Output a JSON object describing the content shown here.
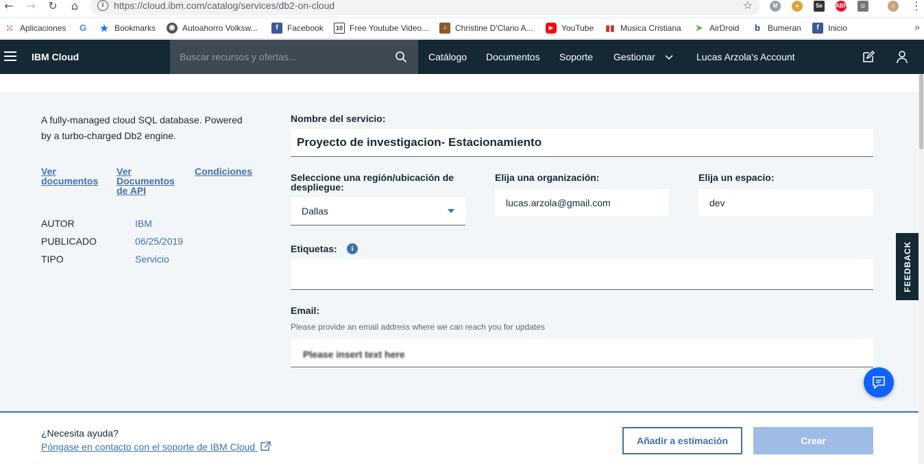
{
  "browser": {
    "url": "https://cloud.ibm.com/catalog/services/db2-on-cloud",
    "bookmarks": [
      {
        "label": "Aplicaciones",
        "icon": "apps-grid-icon",
        "color": "#e8453c"
      },
      {
        "label": "",
        "icon": "google-icon",
        "color": "#4285f4"
      },
      {
        "label": "Bookmarks",
        "icon": "star-icon",
        "color": "#1a73e8"
      },
      {
        "label": "Autoahorro Volksw...",
        "icon": "globe-icon",
        "color": "#555555"
      },
      {
        "label": "Facebook",
        "icon": "facebook-icon",
        "color": "#3b5998"
      },
      {
        "label": "Free Youtube Video...",
        "icon": "10-icon",
        "color": "#333333"
      },
      {
        "label": "Christine D'Clario A...",
        "icon": "music-note-icon",
        "color": "#8a5a2b"
      },
      {
        "label": "YouTube",
        "icon": "youtube-icon",
        "color": "#ff0000"
      },
      {
        "label": "Musica Cristiana",
        "icon": "equalizer-icon",
        "color": "#c0392b"
      },
      {
        "label": "AirDroid",
        "icon": "airdroid-icon",
        "color": "#6ab04c"
      },
      {
        "label": "Bumeran",
        "icon": "bumeran-icon",
        "color": "#1e4e8c"
      },
      {
        "label": "Inicio",
        "icon": "facebook-icon",
        "color": "#3b5998"
      }
    ],
    "more": "»"
  },
  "header": {
    "brand": "IBM Cloud",
    "search_placeholder": "Buscar recursos y ofertas...",
    "nav": {
      "catalog": "Catálogo",
      "docs": "Documentos",
      "support": "Soporte",
      "manage": "Gestionar",
      "account": "Lucas Arzola's Account"
    }
  },
  "sidebar": {
    "description": "A fully-managed cloud SQL database. Powered by a turbo-charged Db2 engine.",
    "links": {
      "docs": [
        "Ver",
        "documentos"
      ],
      "api": [
        "Ver",
        "Documentos",
        "de API"
      ],
      "terms": "Condiciones"
    },
    "meta": [
      {
        "key": "AUTOR",
        "value": "IBM"
      },
      {
        "key": "PUBLICADO",
        "value": "06/25/2019"
      },
      {
        "key": "TIPO",
        "value": "Servicio"
      }
    ]
  },
  "form": {
    "service_name_label": "Nombre del servicio:",
    "service_name_value": "Proyecto de investigacion- Estacionamiento",
    "region_label": "Seleccione una región/ubicación de despliegue:",
    "region_value": "Dallas",
    "org_label": "Elija una organización:",
    "org_value": "lucas.arzola@gmail.com",
    "space_label": "Elija un espacio:",
    "space_value": "dev",
    "tags_label": "Etiquetas:",
    "email_label": "Email:",
    "email_hint": "Please provide an email address where we can reach you for updates",
    "email_placeholder": "Please insert text here"
  },
  "feedback": "FEEDBACK",
  "footer": {
    "help_question": "¿Necesita ayuda?",
    "help_link": "Póngase en contacto con el soporte de IBM Cloud",
    "add_estimate": "Añadir a estimación",
    "create": "Crear"
  },
  "colors": {
    "header_bg": "#152935",
    "link": "#3d70b2",
    "create_disabled": "#9ebce6"
  }
}
